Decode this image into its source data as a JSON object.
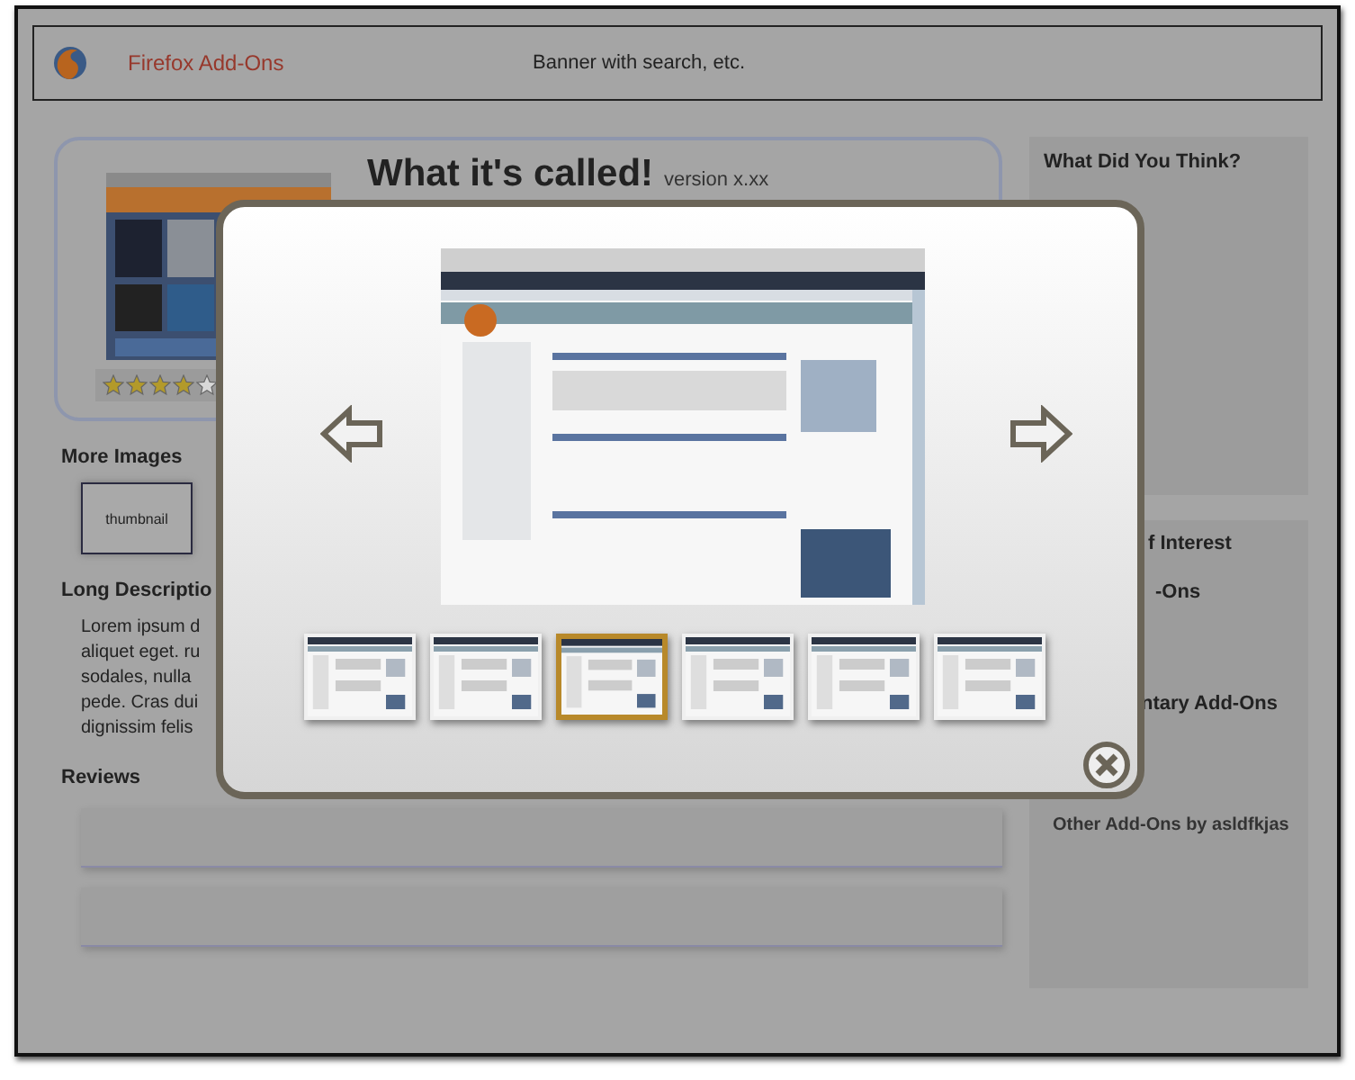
{
  "banner": {
    "brand": "Firefox Add-Ons",
    "text": "Banner with search, etc."
  },
  "addon": {
    "title": "What it's called!",
    "version": "version x.xx",
    "stars": 4
  },
  "more_images": {
    "heading": "More Images",
    "thumbnails": [
      "thumbnail"
    ]
  },
  "description": {
    "heading": "Long Descriptio",
    "lines": [
      "Lorem ipsum d",
      "aliquet eget. ru",
      "sodales, nulla",
      "pede. Cras dui",
      "dignissim felis"
    ]
  },
  "reviews": {
    "heading": "Reviews",
    "cards": [
      {
        "kind": "placeholder"
      },
      {
        "kind": "placeholder"
      }
    ]
  },
  "sidebar": {
    "feedback_heading": "What Did You Think?",
    "related": [
      {
        "kind": "heading",
        "text": "f Interest"
      },
      {
        "kind": "heading",
        "text": "-Ons"
      },
      {
        "kind": "heading",
        "text": "ntary Add-Ons"
      },
      {
        "kind": "link",
        "text": "Other Add-Ons by asldfkjas"
      }
    ]
  },
  "lightbox": {
    "thumbnails": [
      {
        "selected": false
      },
      {
        "selected": false
      },
      {
        "selected": true
      },
      {
        "selected": false
      },
      {
        "selected": false
      },
      {
        "selected": false
      }
    ]
  }
}
